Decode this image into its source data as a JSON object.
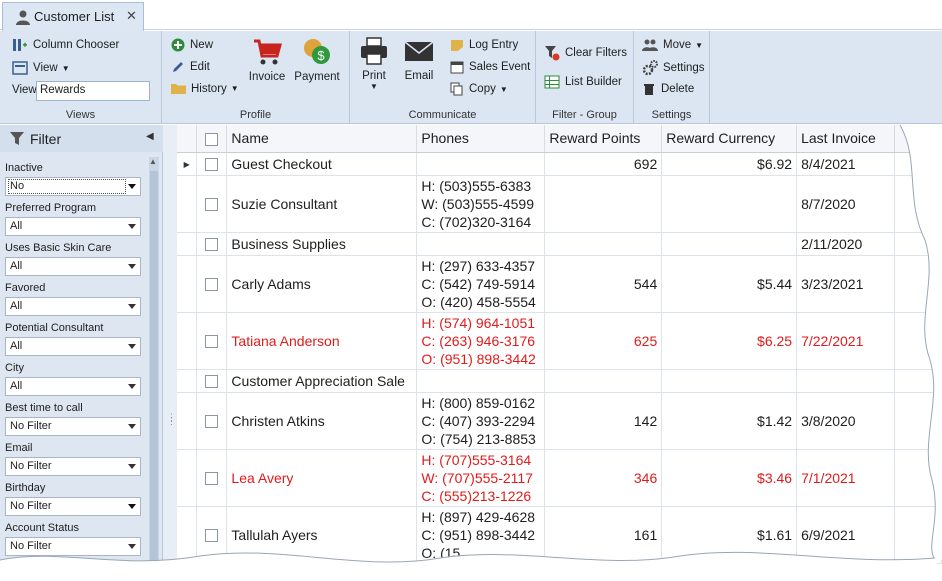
{
  "tab": {
    "title": "Customer List",
    "close": "✕"
  },
  "ribbon": {
    "views": {
      "column_chooser": "Column Chooser",
      "view": "View",
      "view_label": "View",
      "view_value": "Rewards",
      "label": "Views"
    },
    "profile": {
      "new": "New",
      "edit": "Edit",
      "history": "History",
      "invoice": "Invoice",
      "payment": "Payment",
      "label": "Profile"
    },
    "communicate": {
      "print": "Print",
      "email": "Email",
      "log_entry": "Log Entry",
      "sales_event": "Sales Event",
      "copy": "Copy",
      "label": "Communicate"
    },
    "filter_group": {
      "clear_filters": "Clear Filters",
      "list_builder": "List Builder",
      "label": "Filter - Group"
    },
    "settings": {
      "move": "Move",
      "settings": "Settings",
      "delete": "Delete",
      "label": "Settings"
    }
  },
  "filter": {
    "title": "Filter",
    "fields": [
      {
        "label": "Inactive",
        "value": "No"
      },
      {
        "label": "Preferred Program",
        "value": "All"
      },
      {
        "label": "Uses Basic Skin Care",
        "value": "All"
      },
      {
        "label": "Favored",
        "value": "All"
      },
      {
        "label": "Potential Consultant",
        "value": "All"
      },
      {
        "label": "City",
        "value": "All"
      },
      {
        "label": "Best time to call",
        "value": "No Filter"
      },
      {
        "label": "Email",
        "value": "No Filter"
      },
      {
        "label": "Birthday",
        "value": "No Filter"
      },
      {
        "label": "Account Status",
        "value": "No Filter"
      }
    ]
  },
  "grid": {
    "columns": [
      "Name",
      "Phones",
      "Reward Points",
      "Reward Currency",
      "Last Invoice"
    ],
    "rows": [
      {
        "name": "Guest  Checkout",
        "phones": [],
        "points": "692",
        "currency": "$6.92",
        "last": "8/4/2021"
      },
      {
        "name": "Suzie  Consultant",
        "phones": [
          "H: (503)555-6383",
          "W: (503)555-4599",
          "C: (702)320-3164"
        ],
        "points": "",
        "currency": "",
        "last": "8/7/2020"
      },
      {
        "name": "Business  Supplies",
        "phones": [],
        "points": "",
        "currency": "",
        "last": "2/11/2020"
      },
      {
        "name": "Carly Adams",
        "phones": [
          "H: (297) 633-4357",
          "C: (542) 749-5914",
          "O: (420) 458-5554"
        ],
        "points": "544",
        "currency": "$5.44",
        "last": "3/23/2021"
      },
      {
        "name": "Tatiana Anderson",
        "phones": [
          "H: (574) 964-1051",
          "C: (263) 946-3176",
          "O: (951) 898-3442"
        ],
        "points": "625",
        "currency": "$6.25",
        "last": "7/22/2021"
      },
      {
        "name": "Customer Appreciation Sale",
        "phones": [],
        "points": "",
        "currency": "",
        "last": ""
      },
      {
        "name": "Christen Atkins",
        "phones": [
          "H: (800) 859-0162",
          "C: (407) 393-2294",
          "O: (754) 213-8853"
        ],
        "points": "142",
        "currency": "$1.42",
        "last": "3/8/2020"
      },
      {
        "name": "Lea Avery",
        "phones": [
          "H: (707)555-3164",
          "W: (707)555-2117",
          "C: (555)213-1226"
        ],
        "points": "346",
        "currency": "$3.46",
        "last": "7/1/2021"
      },
      {
        "name": "Tallulah Ayers",
        "phones": [
          "H: (897) 429-4628",
          "C: (951) 898-3442",
          "O: (15"
        ],
        "points": "161",
        "currency": "$1.61",
        "last": "6/9/2021"
      }
    ]
  },
  "colors": {
    "highlight_text": "#e01b1b",
    "ribbon_bg": "#dce6f2",
    "panel_bg": "#dde6f1"
  }
}
